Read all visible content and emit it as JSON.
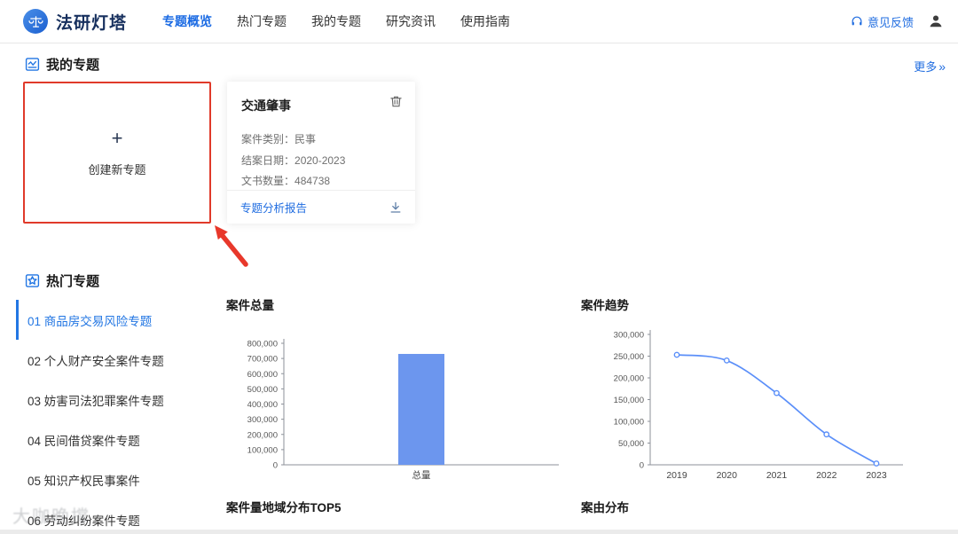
{
  "header": {
    "brand": "法研灯塔",
    "nav": [
      {
        "label": "专题概览",
        "active": true
      },
      {
        "label": "热门专题",
        "active": false
      },
      {
        "label": "我的专题",
        "active": false
      },
      {
        "label": "研究资讯",
        "active": false
      },
      {
        "label": "使用指南",
        "active": false
      }
    ],
    "feedback_label": "意见反馈"
  },
  "my_topics": {
    "title": "我的专题",
    "more_label": "更多",
    "more_chevron": "»",
    "create_card": {
      "plus": "+",
      "label": "创建新专题"
    },
    "topic_card": {
      "title": "交通肇事",
      "fields": [
        {
          "label": "案件类别：",
          "value": "民事"
        },
        {
          "label": "结案日期：",
          "value": "2020-2023"
        },
        {
          "label": "文书数量：",
          "value": "484738"
        }
      ],
      "report_label": "专题分析报告"
    }
  },
  "hot_topics": {
    "title": "热门专题",
    "items": [
      {
        "label": "01 商品房交易风险专题",
        "active": true
      },
      {
        "label": "02 个人财产安全案件专题",
        "active": false
      },
      {
        "label": "03 妨害司法犯罪案件专题",
        "active": false
      },
      {
        "label": "04 民间借贷案件专题",
        "active": false
      },
      {
        "label": "05 知识产权民事案件",
        "active": false
      },
      {
        "label": "06 劳动纠纷案件专题",
        "active": false
      }
    ],
    "panel_titles": {
      "region": "案件量地域分布TOP5",
      "cause": "案由分布"
    }
  },
  "chart_data": [
    {
      "type": "bar",
      "title": "案件总量",
      "categories": [
        "总量"
      ],
      "values": [
        730000
      ],
      "ylim": [
        0,
        800000
      ],
      "ytick_step": 100000,
      "bar_color": "#6c96ee",
      "grid": false,
      "legend": "none"
    },
    {
      "type": "line",
      "title": "案件趋势",
      "x": [
        "2019",
        "2020",
        "2021",
        "2022",
        "2023"
      ],
      "values": [
        253000,
        240000,
        165000,
        70000,
        3000
      ],
      "ylim": [
        0,
        300000
      ],
      "ytick_step": 50000,
      "line_color": "#5b8ff9",
      "marker": "circle",
      "grid": false,
      "legend": "none"
    }
  ],
  "watermark": "大咖晚撑",
  "colors": {
    "accent_blue": "#1f6ce0",
    "highlight_red": "#e03a2a",
    "bar_blue": "#6c96ee",
    "line_blue": "#5b8ff9"
  }
}
